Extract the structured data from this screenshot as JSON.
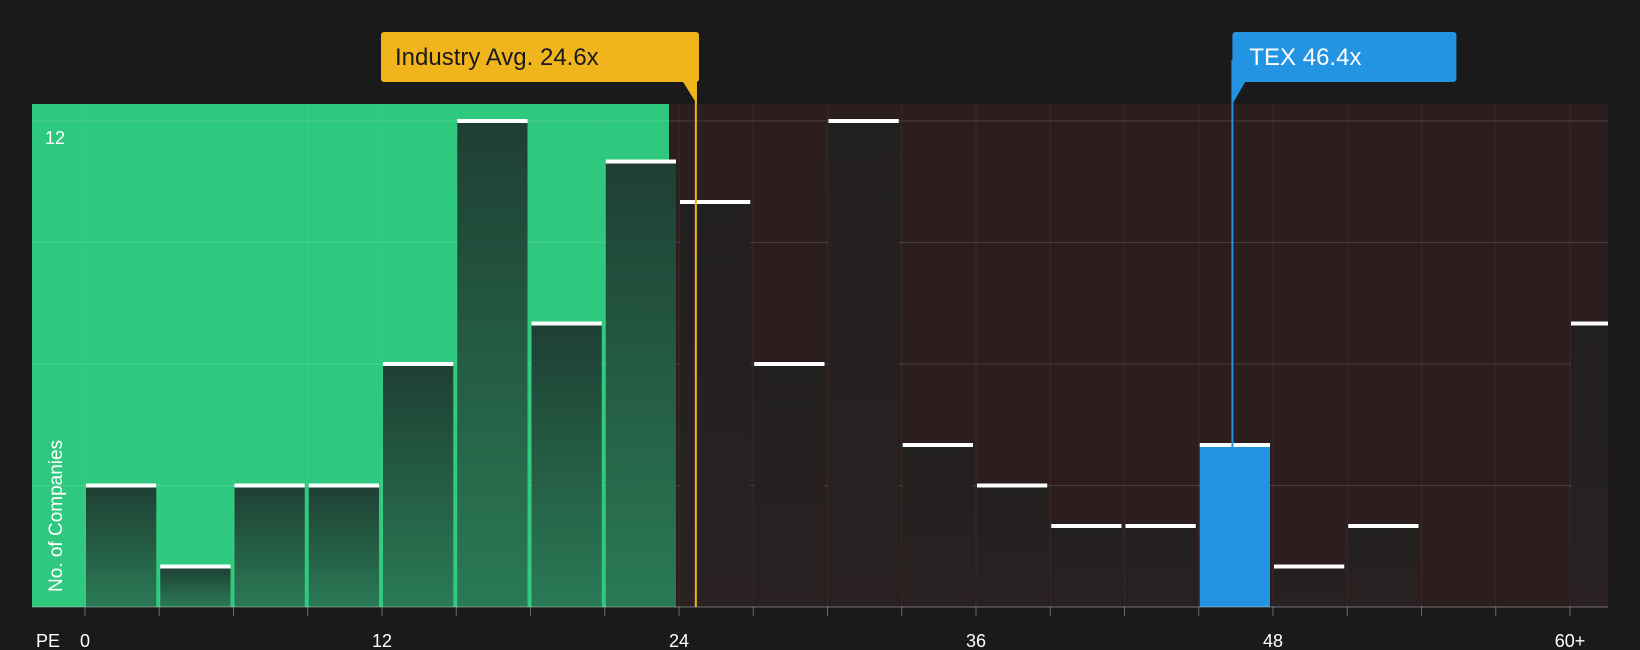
{
  "chart_data": {
    "type": "bar",
    "xlabel": "PE",
    "ylabel": "No. of Companies",
    "x_ticks": [
      "0",
      "12",
      "24",
      "36",
      "48",
      "60+"
    ],
    "y_ticks": [
      "12"
    ],
    "ylim": [
      0,
      12
    ],
    "bin_width": 3,
    "bins": [
      {
        "x": 0,
        "value": 3
      },
      {
        "x": 3,
        "value": 1
      },
      {
        "x": 6,
        "value": 3
      },
      {
        "x": 9,
        "value": 3
      },
      {
        "x": 12,
        "value": 6
      },
      {
        "x": 15,
        "value": 12
      },
      {
        "x": 18,
        "value": 7
      },
      {
        "x": 21,
        "value": 11
      },
      {
        "x": 24,
        "value": 10
      },
      {
        "x": 27,
        "value": 6
      },
      {
        "x": 30,
        "value": 12
      },
      {
        "x": 33,
        "value": 4
      },
      {
        "x": 36,
        "value": 3
      },
      {
        "x": 39,
        "value": 2
      },
      {
        "x": 42,
        "value": 2
      },
      {
        "x": 45,
        "value": 4
      },
      {
        "x": 48,
        "value": 1
      },
      {
        "x": 51,
        "value": 2
      },
      {
        "x": 54,
        "value": 0
      },
      {
        "x": 57,
        "value": 0
      },
      {
        "x": 60,
        "value": 7
      }
    ],
    "industry_avg": {
      "label": "Industry Avg. 24.6x",
      "value": 24.6
    },
    "company": {
      "label": "TEX 46.4x",
      "value": 46.4
    },
    "colors": {
      "background": "#1a1a1a",
      "undervalued_zone": "#2ec97e",
      "overvalued_zone": "#2c1e1e",
      "industry_marker": "#f0b41c",
      "company_marker": "#2394e1",
      "bar_in_green": "#23493a",
      "bar_in_red": "#242020",
      "bar_cap": "#ffffff"
    }
  }
}
